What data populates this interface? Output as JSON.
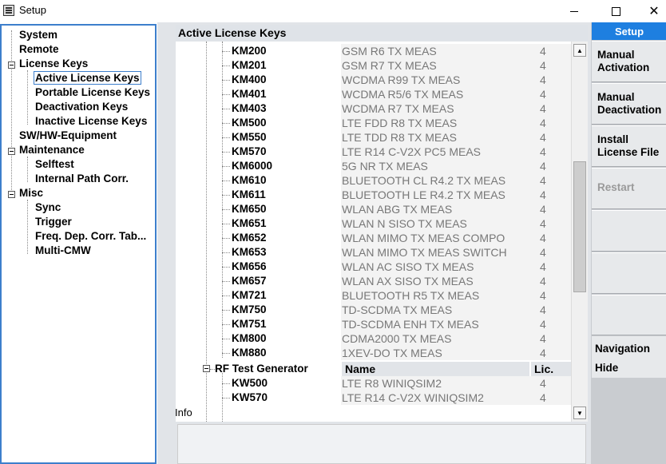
{
  "window": {
    "title": "Setup"
  },
  "tree": {
    "items": [
      {
        "label": "System"
      },
      {
        "label": "Remote"
      },
      {
        "label": "License Keys"
      },
      {
        "label": "Active License Keys"
      },
      {
        "label": "Portable License Keys"
      },
      {
        "label": "Deactivation Keys"
      },
      {
        "label": "Inactive License Keys"
      },
      {
        "label": "SW/HW-Equipment"
      },
      {
        "label": "Maintenance"
      },
      {
        "label": "Selftest"
      },
      {
        "label": "Internal Path Corr."
      },
      {
        "label": "Misc"
      },
      {
        "label": "Sync"
      },
      {
        "label": "Trigger"
      },
      {
        "label": "Freq. Dep. Corr. Tab..."
      },
      {
        "label": "Multi-CMW"
      }
    ]
  },
  "panel": {
    "title": "Active License Keys",
    "keys": [
      {
        "code": "KM200",
        "name": "GSM R6 TX MEAS",
        "count": "4"
      },
      {
        "code": "KM201",
        "name": "GSM R7 TX MEAS",
        "count": "4"
      },
      {
        "code": "KM400",
        "name": "WCDMA R99 TX MEAS",
        "count": "4"
      },
      {
        "code": "KM401",
        "name": "WCDMA R5/6 TX MEAS",
        "count": "4"
      },
      {
        "code": "KM403",
        "name": "WCDMA R7 TX MEAS",
        "count": "4"
      },
      {
        "code": "KM500",
        "name": "LTE FDD R8 TX MEAS",
        "count": "4"
      },
      {
        "code": "KM550",
        "name": "LTE TDD R8 TX MEAS",
        "count": "4"
      },
      {
        "code": "KM570",
        "name": "LTE R14 C-V2X PC5 MEAS",
        "count": "4"
      },
      {
        "code": "KM6000",
        "name": "5G NR TX MEAS",
        "count": "4"
      },
      {
        "code": "KM610",
        "name": "BLUETOOTH CL R4.2 TX MEAS",
        "count": "4"
      },
      {
        "code": "KM611",
        "name": "BLUETOOTH LE R4.2 TX MEAS",
        "count": "4"
      },
      {
        "code": "KM650",
        "name": "WLAN ABG TX MEAS",
        "count": "4"
      },
      {
        "code": "KM651",
        "name": "WLAN N SISO TX MEAS",
        "count": "4"
      },
      {
        "code": "KM652",
        "name": "WLAN MIMO TX MEAS COMPO",
        "count": "4"
      },
      {
        "code": "KM653",
        "name": "WLAN MIMO TX MEAS SWITCH",
        "count": "4"
      },
      {
        "code": "KM656",
        "name": "WLAN AC SISO TX MEAS",
        "count": "4"
      },
      {
        "code": "KM657",
        "name": "WLAN AX SISO TX MEAS",
        "count": "4"
      },
      {
        "code": "KM721",
        "name": "BLUETOOTH R5 TX MEAS",
        "count": "4"
      },
      {
        "code": "KM750",
        "name": "TD-SCDMA TX MEAS",
        "count": "4"
      },
      {
        "code": "KM751",
        "name": "TD-SCDMA ENH TX MEAS",
        "count": "4"
      },
      {
        "code": "KM800",
        "name": "CDMA2000 TX MEAS",
        "count": "4"
      },
      {
        "code": "KM880",
        "name": "1XEV-DO TX MEAS",
        "count": "4"
      }
    ],
    "group2": {
      "label": "RF Test Generator",
      "col_name": "Name",
      "col_lic": "Lic.",
      "keys": [
        {
          "code": "KW500",
          "name": "LTE R8 WINIQSIM2",
          "count": "4"
        },
        {
          "code": "KW570",
          "name": "LTE R14 C-V2X WINIQSIM2",
          "count": "4"
        }
      ]
    },
    "info_label": "Info"
  },
  "softkeys": {
    "header": "Setup",
    "manual_activation": "Manual Activation",
    "manual_deactivation": "Manual Deactivation",
    "install_license_file": "Install License File",
    "restart": "Restart",
    "navigation": "Navigation",
    "hide": "Hide"
  }
}
